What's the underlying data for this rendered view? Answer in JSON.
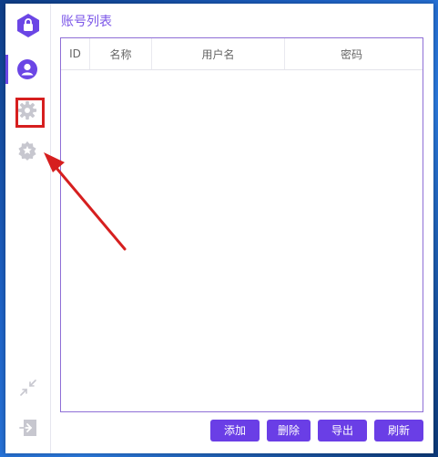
{
  "page": {
    "title": "账号列表"
  },
  "sidebar": {
    "items": [
      {
        "name": "account",
        "icon": "user-circle-icon",
        "active": true
      },
      {
        "name": "settings",
        "icon": "gear-icon",
        "active": false
      },
      {
        "name": "favorites",
        "icon": "star-badge-icon",
        "active": false
      }
    ],
    "bottom": [
      {
        "icon": "collapse-arrows-icon"
      },
      {
        "icon": "exit-icon"
      }
    ]
  },
  "table": {
    "columns": [
      "ID",
      "名称",
      "用户名",
      "密码"
    ],
    "rows": []
  },
  "toolbar": {
    "add_label": "添加",
    "delete_label": "删除",
    "export_label": "导出",
    "refresh_label": "刷新"
  },
  "colors": {
    "accent": "#6a3ee6",
    "highlight": "#d61f1f"
  }
}
